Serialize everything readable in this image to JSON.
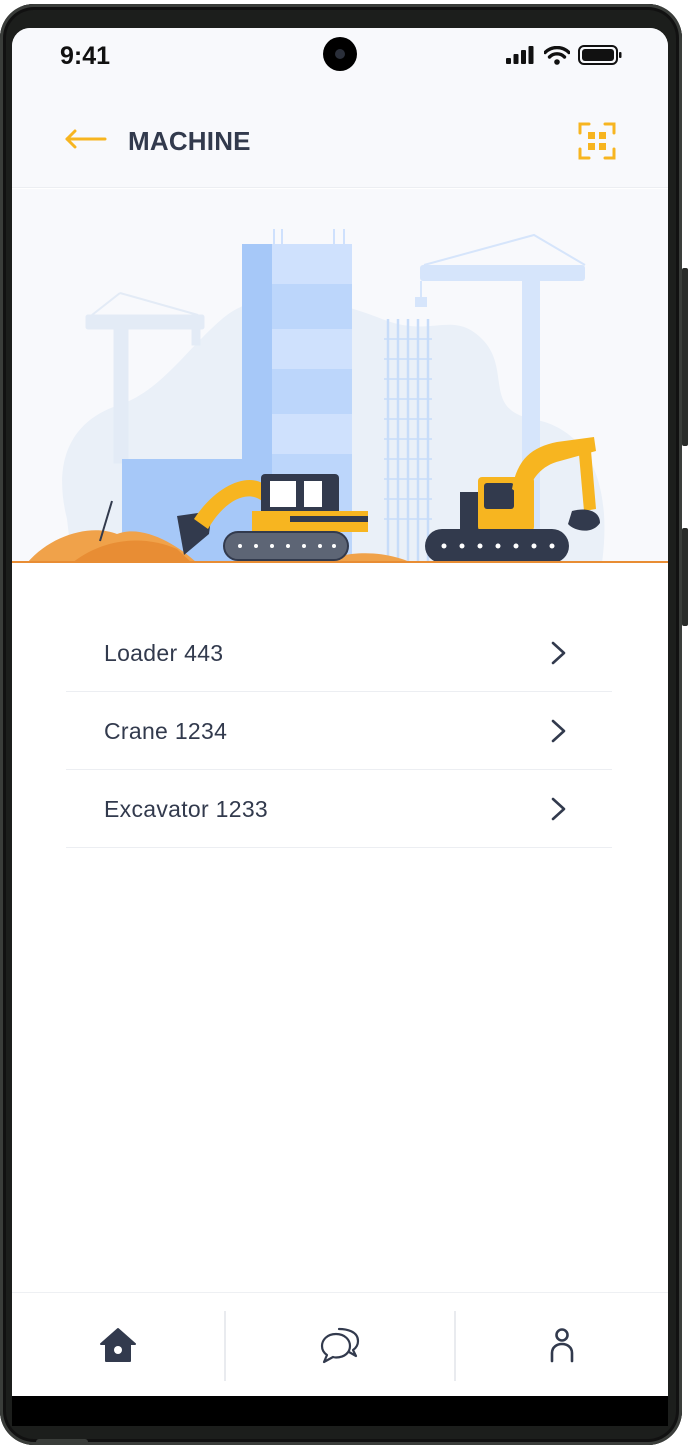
{
  "status_bar": {
    "time": "9:41",
    "icons": [
      "signal-icon",
      "wifi-icon",
      "battery-icon"
    ]
  },
  "header": {
    "title": "MACHINE",
    "back_icon": "arrow-left-icon",
    "scan_icon": "qr-scan-icon"
  },
  "illustration": {
    "description_icon": "construction-site-illustration"
  },
  "machines": [
    {
      "label": "Loader 443",
      "icon": "chevron-right-icon"
    },
    {
      "label": "Crane 1234",
      "icon": "chevron-right-icon"
    },
    {
      "label": "Excavator 1233",
      "icon": "chevron-right-icon"
    }
  ],
  "bottom_nav": {
    "items": [
      {
        "icon": "home-icon"
      },
      {
        "icon": "chat-icon"
      },
      {
        "icon": "profile-icon"
      }
    ]
  },
  "colors": {
    "accent": "#f7b520",
    "text": "#323a4d",
    "background": "#f8f9fc",
    "divider": "#eceef2"
  }
}
